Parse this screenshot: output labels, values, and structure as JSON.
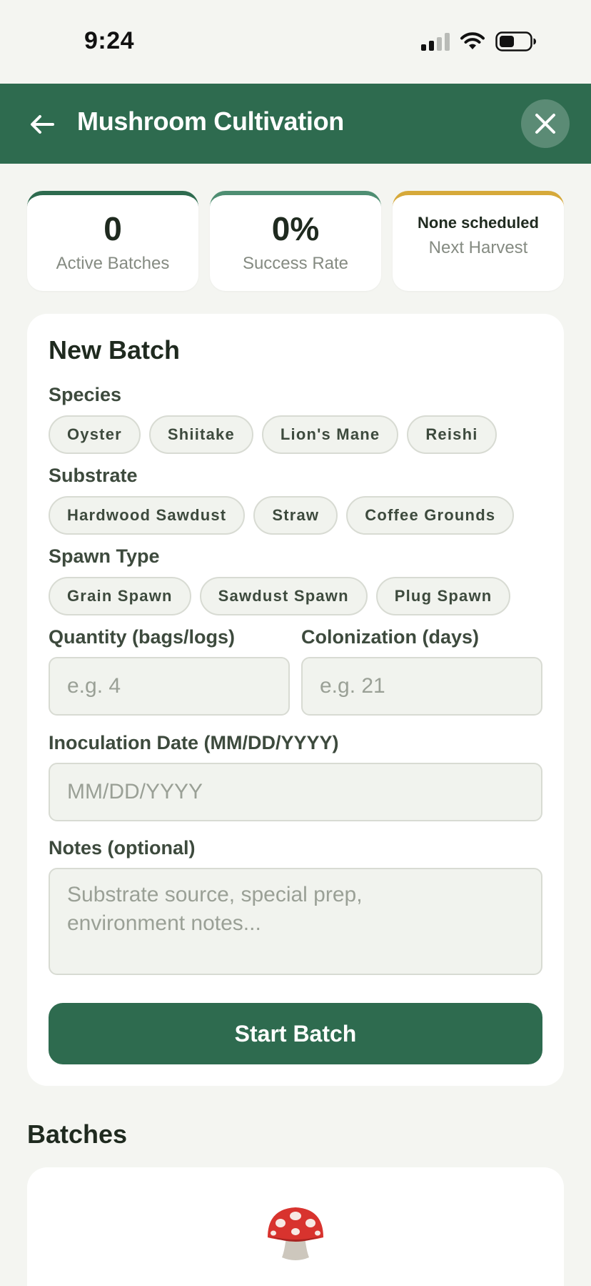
{
  "status_bar": {
    "time": "9:24"
  },
  "header": {
    "title": "Mushroom Cultivation"
  },
  "stats": {
    "active_batches": {
      "value": "0",
      "label": "Active Batches"
    },
    "success_rate": {
      "value": "0%",
      "label": "Success Rate"
    },
    "next_harvest": {
      "value": "None scheduled",
      "label": "Next Harvest"
    }
  },
  "form": {
    "title": "New Batch",
    "species": {
      "label": "Species",
      "options": [
        "Oyster",
        "Shiitake",
        "Lion's Mane",
        "Reishi"
      ]
    },
    "substrate": {
      "label": "Substrate",
      "options": [
        "Hardwood Sawdust",
        "Straw",
        "Coffee Grounds"
      ]
    },
    "spawn_type": {
      "label": "Spawn Type",
      "options": [
        "Grain Spawn",
        "Sawdust Spawn",
        "Plug Spawn"
      ]
    },
    "quantity": {
      "label": "Quantity (bags/logs)",
      "placeholder": "e.g. 4",
      "value": ""
    },
    "colonization": {
      "label": "Colonization (days)",
      "placeholder": "e.g. 21",
      "value": ""
    },
    "inoculation_date": {
      "label": "Inoculation Date (MM/DD/YYYY)",
      "placeholder": "MM/DD/YYYY",
      "value": ""
    },
    "notes": {
      "label": "Notes (optional)",
      "placeholder": "Substrate source, special prep,\nenvironment notes...",
      "value": ""
    },
    "submit_label": "Start Batch"
  },
  "batches": {
    "heading": "Batches",
    "empty_icon": "mushroom-icon"
  },
  "colors": {
    "primary": "#2e6b4f",
    "success": "#4e8e72",
    "harvest": "#d6a93a",
    "background": "#f4f5f1"
  }
}
